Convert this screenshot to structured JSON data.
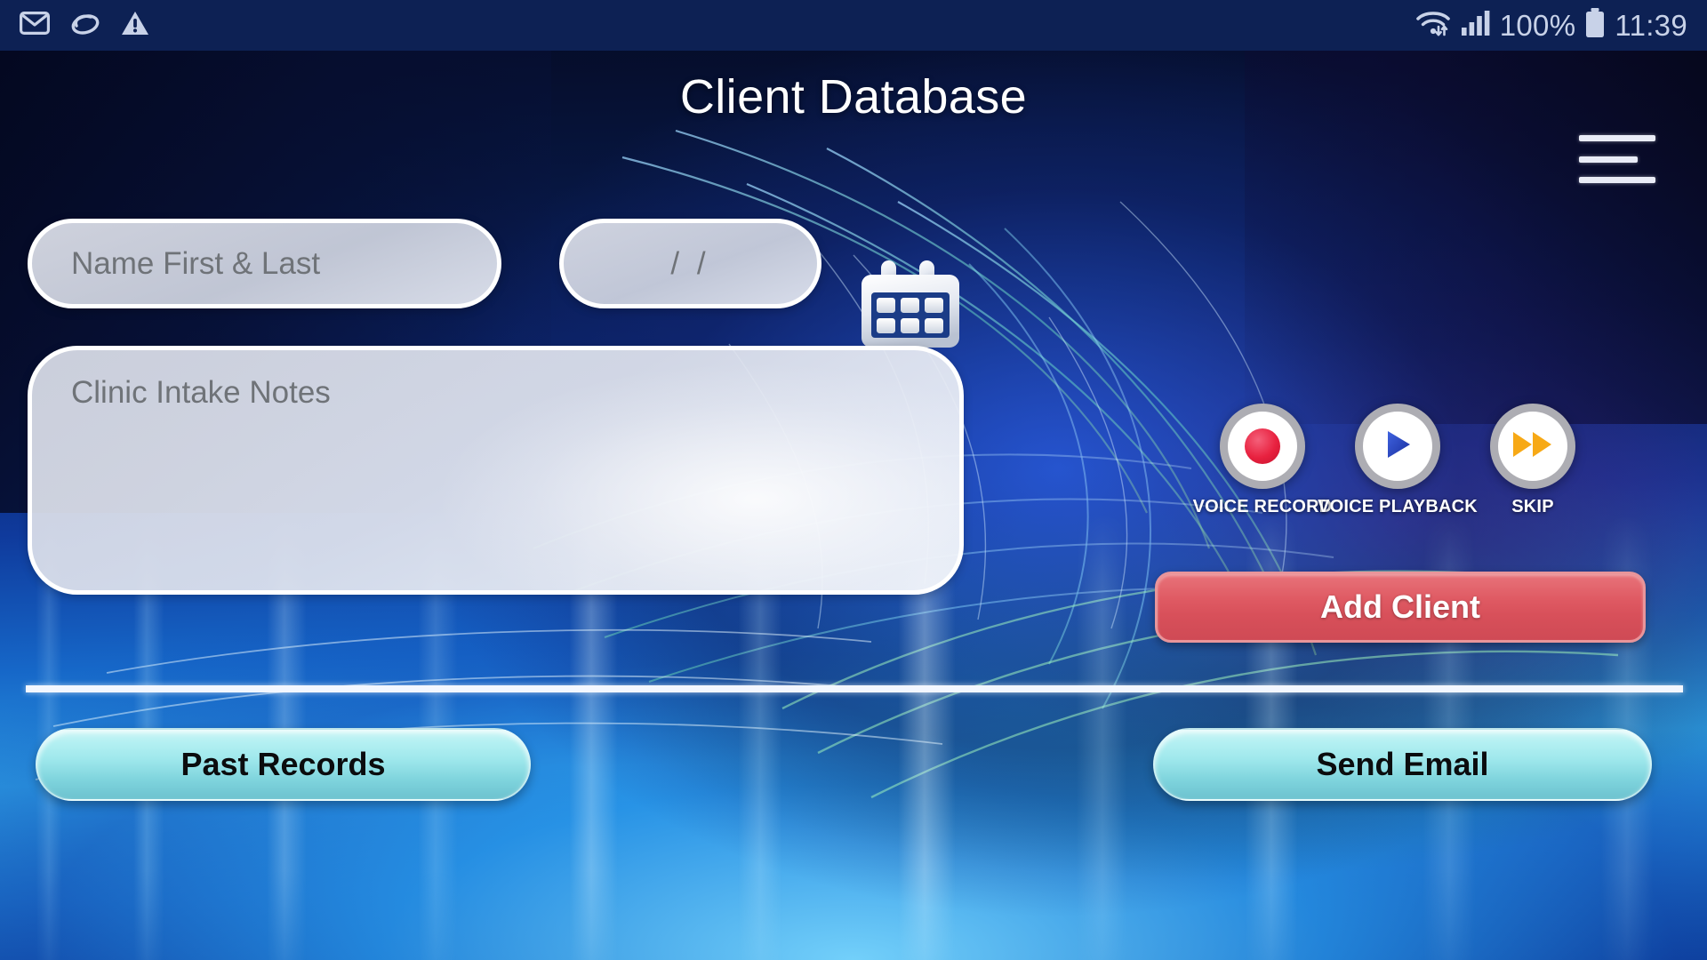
{
  "status_bar": {
    "left_icons": [
      {
        "name": "gmail-icon",
        "label": "Gmail"
      },
      {
        "name": "swirl-app-icon",
        "label": "App notification"
      },
      {
        "name": "warning-triangle-icon",
        "label": "Warning"
      }
    ],
    "wifi_icon": "wifi-icon",
    "signal_icon": "cellular-signal-icon",
    "battery_percent": "100%",
    "battery_icon": "battery-full-icon",
    "clock": "11:39"
  },
  "header": {
    "title": "Client Database",
    "menu_icon": "hamburger-menu-icon"
  },
  "form": {
    "name_placeholder": "Name First & Last",
    "name_value": "",
    "date_placeholder": "  /    /  ",
    "date_value": "",
    "calendar_icon": "calendar-icon",
    "notes_placeholder": "Clinic Intake Notes",
    "notes_value": ""
  },
  "voice_controls": [
    {
      "label": "VOICE RECORD",
      "icon": "record-dot-icon"
    },
    {
      "label": "VOICE PLAYBACK",
      "icon": "play-triangle-icon"
    },
    {
      "label": "SKIP",
      "icon": "fast-forward-icon"
    }
  ],
  "actions": {
    "add_client": "Add Client",
    "past_records": "Past Records",
    "send_email": "Send Email"
  },
  "colors": {
    "status_bar_bg": "#0d2154",
    "add_client_red": "#df5a63",
    "aqua_button": "#9fe8ec",
    "record_red": "#e8213f",
    "play_blue": "#2346c8",
    "skip_orange": "#f7a916",
    "divider_white": "#f3f7ff"
  }
}
